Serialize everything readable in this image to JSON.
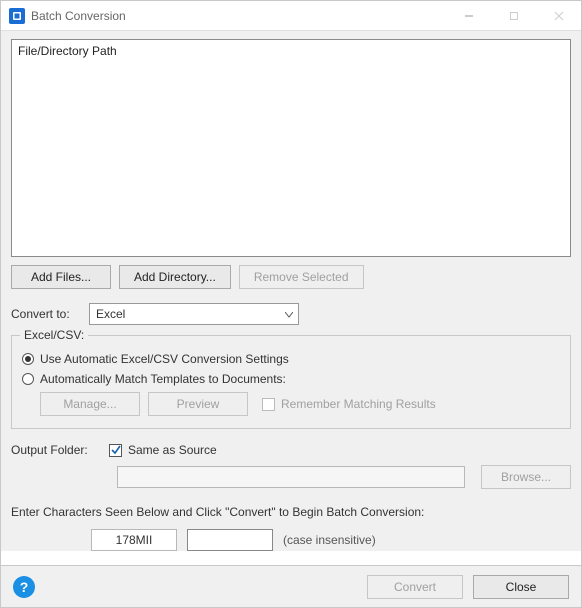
{
  "window": {
    "title": "Batch Conversion"
  },
  "filelist": {
    "header": "File/Directory Path"
  },
  "buttons": {
    "add_files": "Add Files...",
    "add_directory": "Add Directory...",
    "remove_selected": "Remove Selected",
    "manage": "Manage...",
    "preview": "Preview",
    "browse": "Browse...",
    "convert": "Convert",
    "close": "Close"
  },
  "convert": {
    "label": "Convert to:",
    "value": "Excel"
  },
  "excel_csv": {
    "legend": "Excel/CSV:",
    "option_auto": "Use Automatic Excel/CSV Conversion Settings",
    "option_match": "Automatically Match Templates to Documents:",
    "remember": "Remember Matching Results"
  },
  "output": {
    "label": "Output Folder:",
    "same_as_source": "Same as Source",
    "path": ""
  },
  "captcha": {
    "instruction": "Enter Characters Seen Below and Click \"Convert\" to Begin Batch Conversion:",
    "code": "178MII",
    "hint": "(case insensitive)",
    "input": ""
  },
  "help": {
    "glyph": "?"
  }
}
